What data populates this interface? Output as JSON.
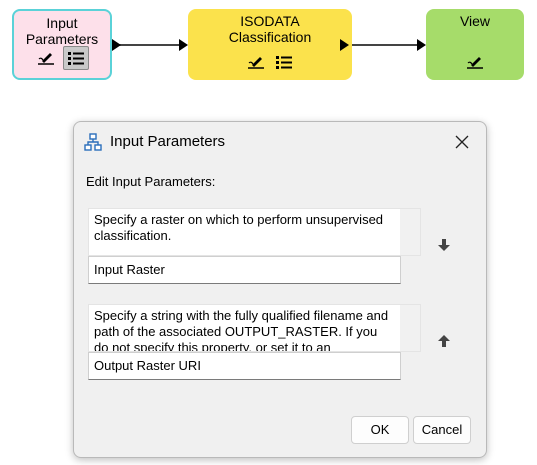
{
  "workflow": {
    "nodes": [
      {
        "title_line1": "Input",
        "title_line2": "Parameters",
        "color": "#fde0ea",
        "border": "#5ad2d8"
      },
      {
        "title_line1": "ISODATA",
        "title_line2": "Classification",
        "color": "#fbe24c"
      },
      {
        "title_line1": "View",
        "title_line2": "",
        "color": "#a6dc6a"
      }
    ]
  },
  "dialog": {
    "title": "Input Parameters",
    "heading": "Edit Input Parameters:",
    "params": [
      {
        "description": "Specify a raster on which to perform unsupervised classification.",
        "name": "Input Raster"
      },
      {
        "description": "Specify a string with the fully qualified filename and path of the associated OUTPUT_RASTER. If you do not specify this property, or set it to an",
        "name": "Output Raster URI"
      }
    ],
    "ok_label": "OK",
    "cancel_label": "Cancel"
  }
}
